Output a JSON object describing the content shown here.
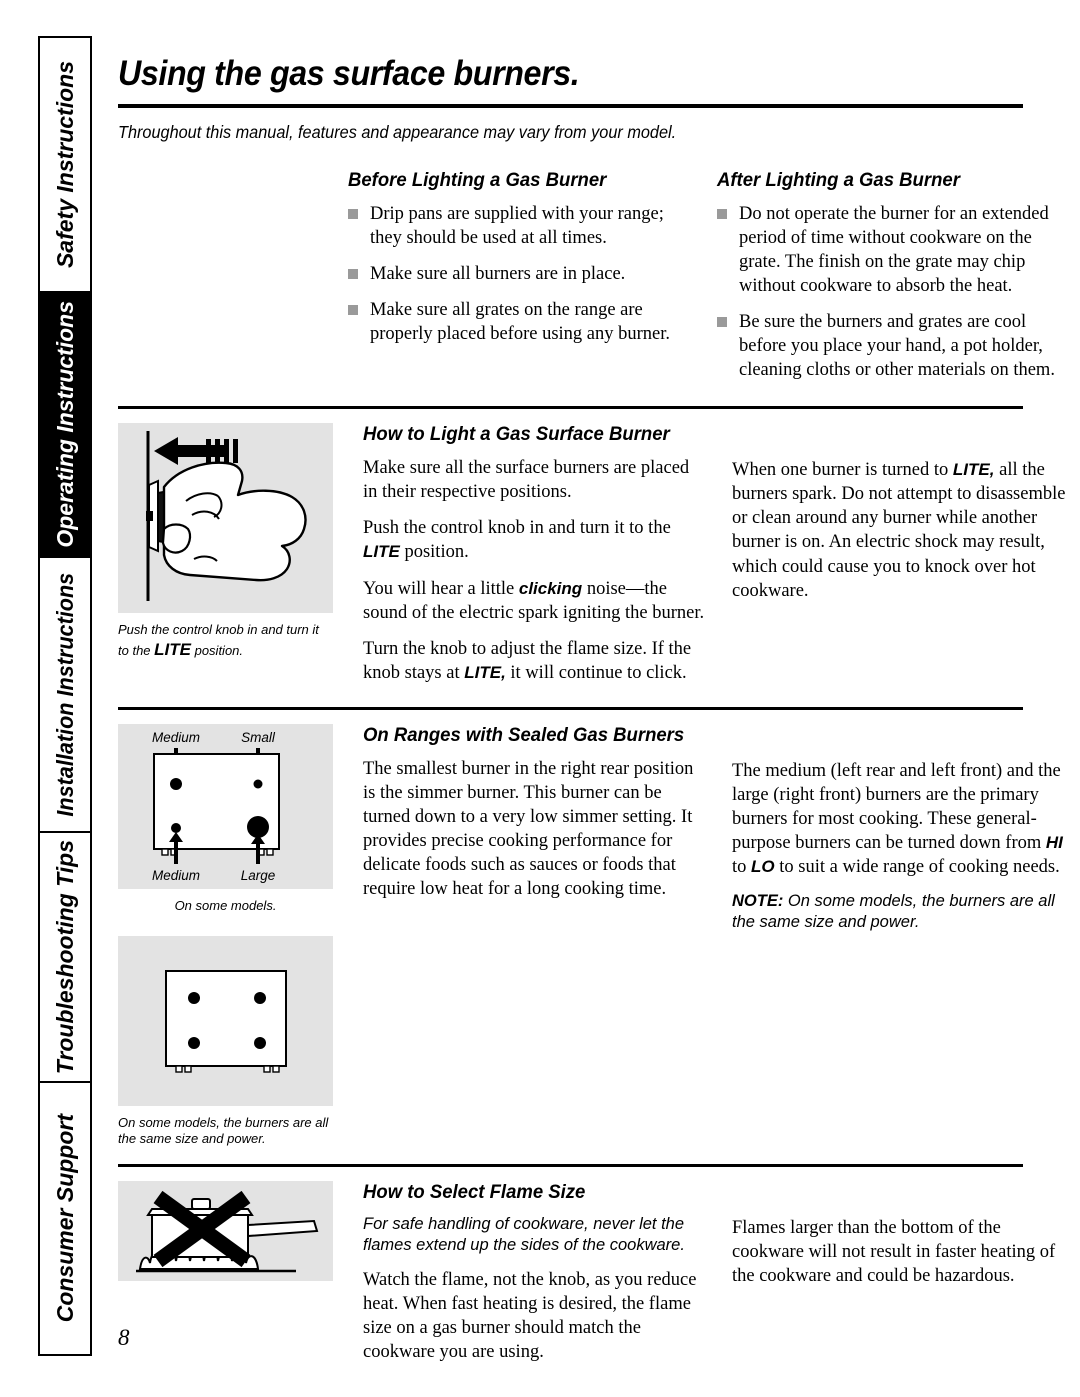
{
  "sidebar": {
    "tabs": [
      {
        "label": "Safety Instructions",
        "active": false
      },
      {
        "label": "Operating Instructions",
        "active": true
      },
      {
        "label": "Installation Instructions",
        "active": false
      },
      {
        "label": "Troubleshooting Tips",
        "active": false
      },
      {
        "label": "Consumer Support",
        "active": false
      }
    ]
  },
  "page": {
    "title": "Using the gas surface burners.",
    "intro": "Throughout this manual, features and appearance may vary from your model.",
    "number": "8"
  },
  "section_before_after": {
    "left": {
      "heading": "Before Lighting a Gas Burner",
      "bullets": [
        "Drip pans are supplied with your range; they should be used at all times.",
        "Make sure all burners are in place.",
        "Make sure all grates on the range are properly placed before using any burner."
      ]
    },
    "right": {
      "heading": "After Lighting a Gas Burner",
      "bullets": [
        "Do not operate the burner for an extended period of time without cookware on the grate. The finish on the grate may chip without cookware to absorb the heat.",
        "Be sure the burners and grates are cool before you place your hand, a pot holder, cleaning cloths or other materials on them."
      ]
    }
  },
  "section_light": {
    "heading": "How to Light a Gas Surface Burner",
    "figure_caption_a": "Push the control knob in and turn it",
    "figure_caption_b": "to the ",
    "figure_caption_lite": "LITE",
    "figure_caption_c": " position.",
    "left_paragraphs": [
      "Make sure all the surface burners are placed in their respective positions.",
      "Push the control knob in and turn it to the LITE position.",
      "You will hear a little clicking noise—the sound of the electric spark igniting the burner.",
      "Turn the knob to adjust the flame size. If the knob stays at LITE, it will continue to click."
    ],
    "right_paragraph": "When one burner is turned to LITE, all the burners spark. Do not attempt to disassemble or clean around any burner while another burner is on. An electric shock may result, which could cause you to knock over hot cookware.",
    "p2_a": "Push the control knob in and turn it to the ",
    "p2_lite": "LITE",
    "p2_b": " position.",
    "p3_a": "You will hear a little ",
    "p3_em": "clicking",
    "p3_b": " noise—the sound of the electric spark igniting the burner.",
    "p4_a": "Turn the knob to adjust the flame size. If the knob stays at ",
    "p4_lite": "LITE,",
    "p4_b": " it will continue to click.",
    "r_a": "When one burner is turned to ",
    "r_lite": "LITE,",
    "r_b": " all the burners spark. Do not attempt to disassemble or clean around any burner while another burner is on. An electric shock may result, which could cause you to knock over hot cookware."
  },
  "section_sealed": {
    "heading": "On Ranges with Sealed Gas Burners",
    "left_paragraph": "The smallest burner in the right rear position is the simmer burner. This burner can be turned down to a very low simmer setting. It provides precise cooking performance for delicate foods such as sauces or foods that require low heat for a long cooking time.",
    "right_a": "The medium (left rear and left front) and the large (right front) burners are the primary burners for most cooking. These general-purpose burners can be turned down from ",
    "right_hi": "HI",
    "right_mid": " to ",
    "right_lo": "LO",
    "right_b": " to suit a wide range of cooking needs.",
    "note_label": "NOTE:",
    "note_text": " On some models, the burners are all the same size and power.",
    "diagram1": {
      "labels": {
        "top_left": "Medium",
        "top_right": "Small",
        "bottom_left": "Medium",
        "bottom_right": "Large"
      },
      "caption": "On some models."
    },
    "diagram2": {
      "caption": "On some models, the burners are all the same size and power."
    }
  },
  "section_flame": {
    "heading": "How to Select Flame Size",
    "italic_paragraph": "For safe handling of cookware, never let the flames extend up the sides of the cookware.",
    "left_paragraph": "Watch the flame, not the knob, as you reduce heat. When fast heating is desired, the flame size on a gas burner should match the cookware you are using.",
    "right_paragraph": "Flames larger than the bottom of the cookware will not result in faster heating of the cookware and could be hazardous."
  },
  "colors": {
    "figure_background": "#e3e3e3",
    "bullet": "#9a9a9a",
    "active_tab_background": "#000000",
    "rule": "#000000"
  }
}
